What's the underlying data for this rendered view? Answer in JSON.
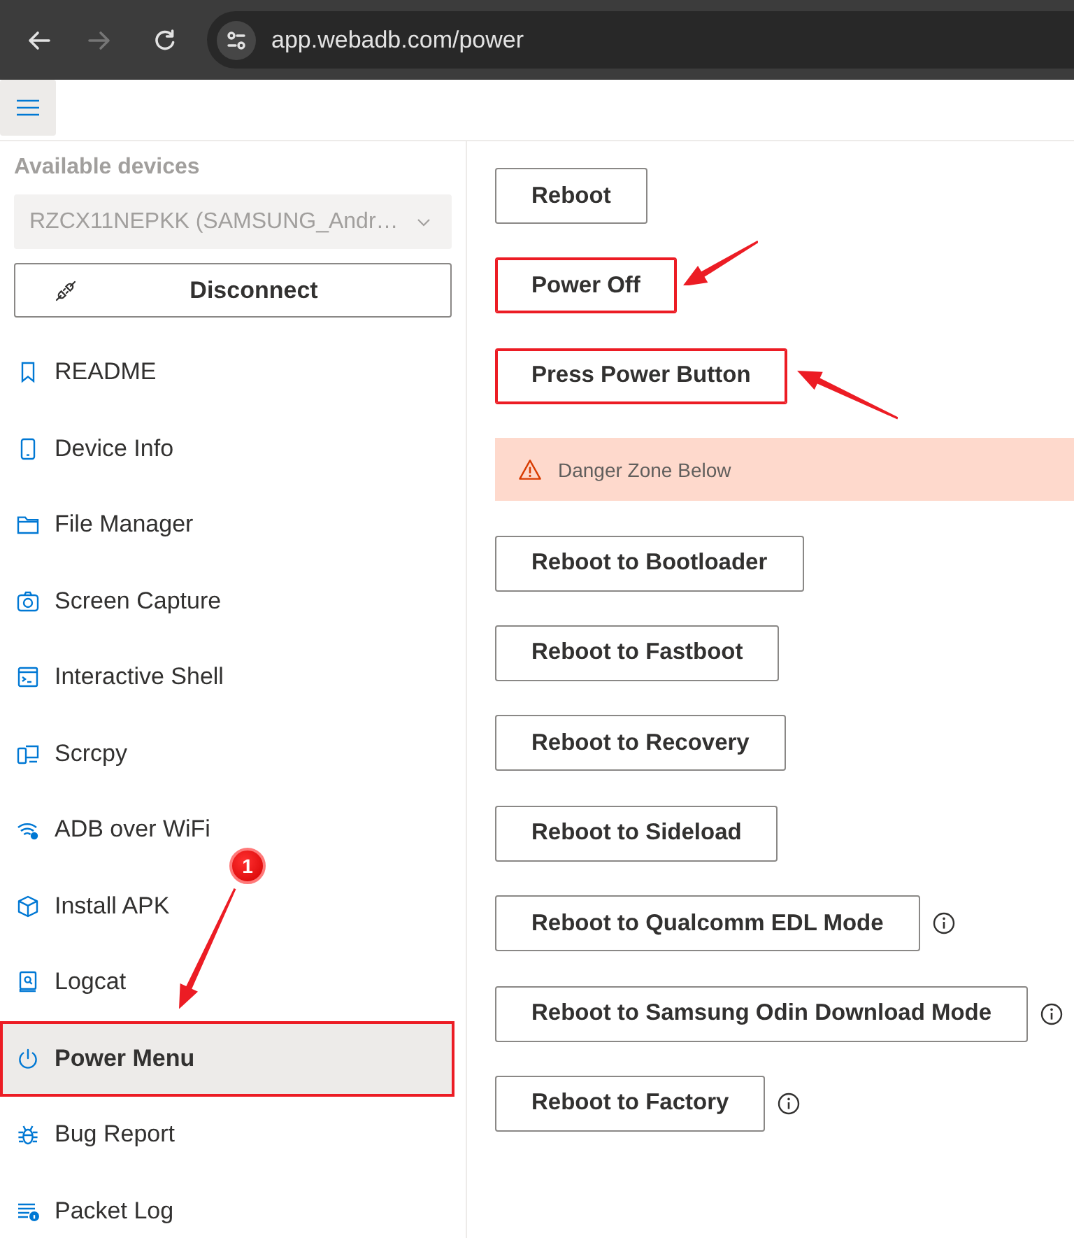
{
  "browser": {
    "back": {
      "disabled": false
    },
    "forward": {
      "disabled": true
    },
    "url": "app.webadb.com/power"
  },
  "sidebar": {
    "title": "Available devices",
    "device_select": {
      "value": "RZCX11NEPKK (SAMSUNG_Andr…",
      "disabled": true
    },
    "disconnect_button": {
      "label": "Disconnect"
    },
    "items": [
      {
        "label": "README",
        "selected": false,
        "highlighted": false
      },
      {
        "label": "Device Info",
        "selected": false,
        "highlighted": false
      },
      {
        "label": "File Manager",
        "selected": false,
        "highlighted": false
      },
      {
        "label": "Screen Capture",
        "selected": false,
        "highlighted": false
      },
      {
        "label": "Interactive Shell",
        "selected": false,
        "highlighted": false
      },
      {
        "label": "Scrcpy",
        "selected": false,
        "highlighted": false
      },
      {
        "label": "ADB over WiFi",
        "selected": false,
        "highlighted": false
      },
      {
        "label": "Install APK",
        "selected": false,
        "highlighted": false
      },
      {
        "label": "Logcat",
        "selected": false,
        "highlighted": false
      },
      {
        "label": "Power Menu",
        "selected": true,
        "highlighted": true,
        "arrow": {
          "kind": "above"
        },
        "badge": "1"
      },
      {
        "label": "Bug Report",
        "selected": false,
        "highlighted": false
      },
      {
        "label": "Packet Log",
        "selected": false,
        "highlighted": false
      }
    ]
  },
  "main": {
    "actions": [
      {
        "label": "Reboot",
        "highlighted": false,
        "info": false
      },
      {
        "label": "Power Off",
        "highlighted": true,
        "info": false,
        "arrow": {
          "kind": "upper_right"
        }
      },
      {
        "label": "Press Power Button",
        "highlighted": true,
        "info": false,
        "arrow": {
          "kind": "lower_right"
        }
      }
    ],
    "warning": {
      "text": "Danger Zone Below"
    },
    "danger_actions": [
      {
        "label": "Reboot to Bootloader",
        "highlighted": false,
        "info": false
      },
      {
        "label": "Reboot to Fastboot",
        "highlighted": false,
        "info": false
      },
      {
        "label": "Reboot to Recovery",
        "highlighted": false,
        "info": false
      },
      {
        "label": "Reboot to Sideload",
        "highlighted": false,
        "info": false
      },
      {
        "label": "Reboot to Qualcomm EDL Mode",
        "highlighted": false,
        "info": true
      },
      {
        "label": "Reboot to Samsung Odin Download Mode",
        "highlighted": false,
        "info": true
      },
      {
        "label": "Reboot to Factory",
        "highlighted": false,
        "info": true
      }
    ]
  }
}
